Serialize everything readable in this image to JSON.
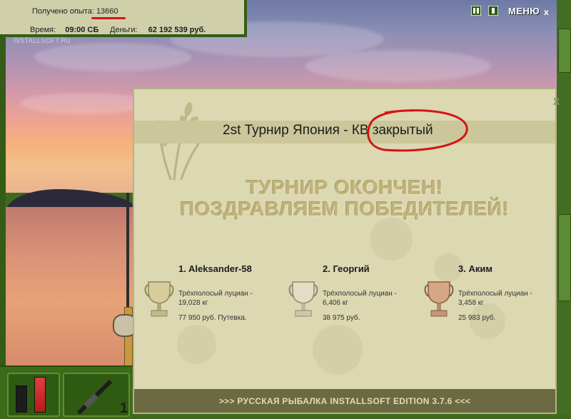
{
  "info": {
    "xp_label": "Получено опыта:",
    "xp_value": "13660",
    "time_label": "Время:",
    "time_value": "09:00 СБ",
    "money_label": "Деньги:",
    "money_value": "62 192 539 руб."
  },
  "watermark": "INSTALLSOFT.RU",
  "topbar": {
    "menu_label": "МЕНЮ",
    "pause_icon": "pause-icon",
    "help_icon": "help-icon",
    "close_label": "x"
  },
  "dialog": {
    "title": "2st Турнир Япония - КВ закрытый",
    "close_label": "X",
    "headline1": "ТУРНИР ОКОНЧЕН!",
    "headline2": "ПОЗДРАВЛЯЕМ ПОБЕДИТЕЛЕЙ!",
    "winners": [
      {
        "name": "1. Aleksander-58",
        "fish_line1": "Трёхполосый луциан -",
        "fish_line2": "19,028 кг",
        "prize": "77 950 руб. Путевка.",
        "cup": "gold"
      },
      {
        "name": "2. Георгий",
        "fish_line1": "Трёхполосый луциан -",
        "fish_line2": "6,406 кг",
        "prize": "38 975 руб.",
        "cup": "silver"
      },
      {
        "name": "3. Аким",
        "fish_line1": "Трёхполосый луциан -",
        "fish_line2": "3,458 кг",
        "prize": "25 983 руб.",
        "cup": "bronze"
      }
    ],
    "footer": ">>> РУССКАЯ РЫБАЛКА INSTALLSOFT EDITION 3.7.6 <<<"
  },
  "colors": {
    "annotation_red": "#d41515",
    "panel_green": "#3c6b19",
    "dialog_bg": "#dcd8b2"
  }
}
